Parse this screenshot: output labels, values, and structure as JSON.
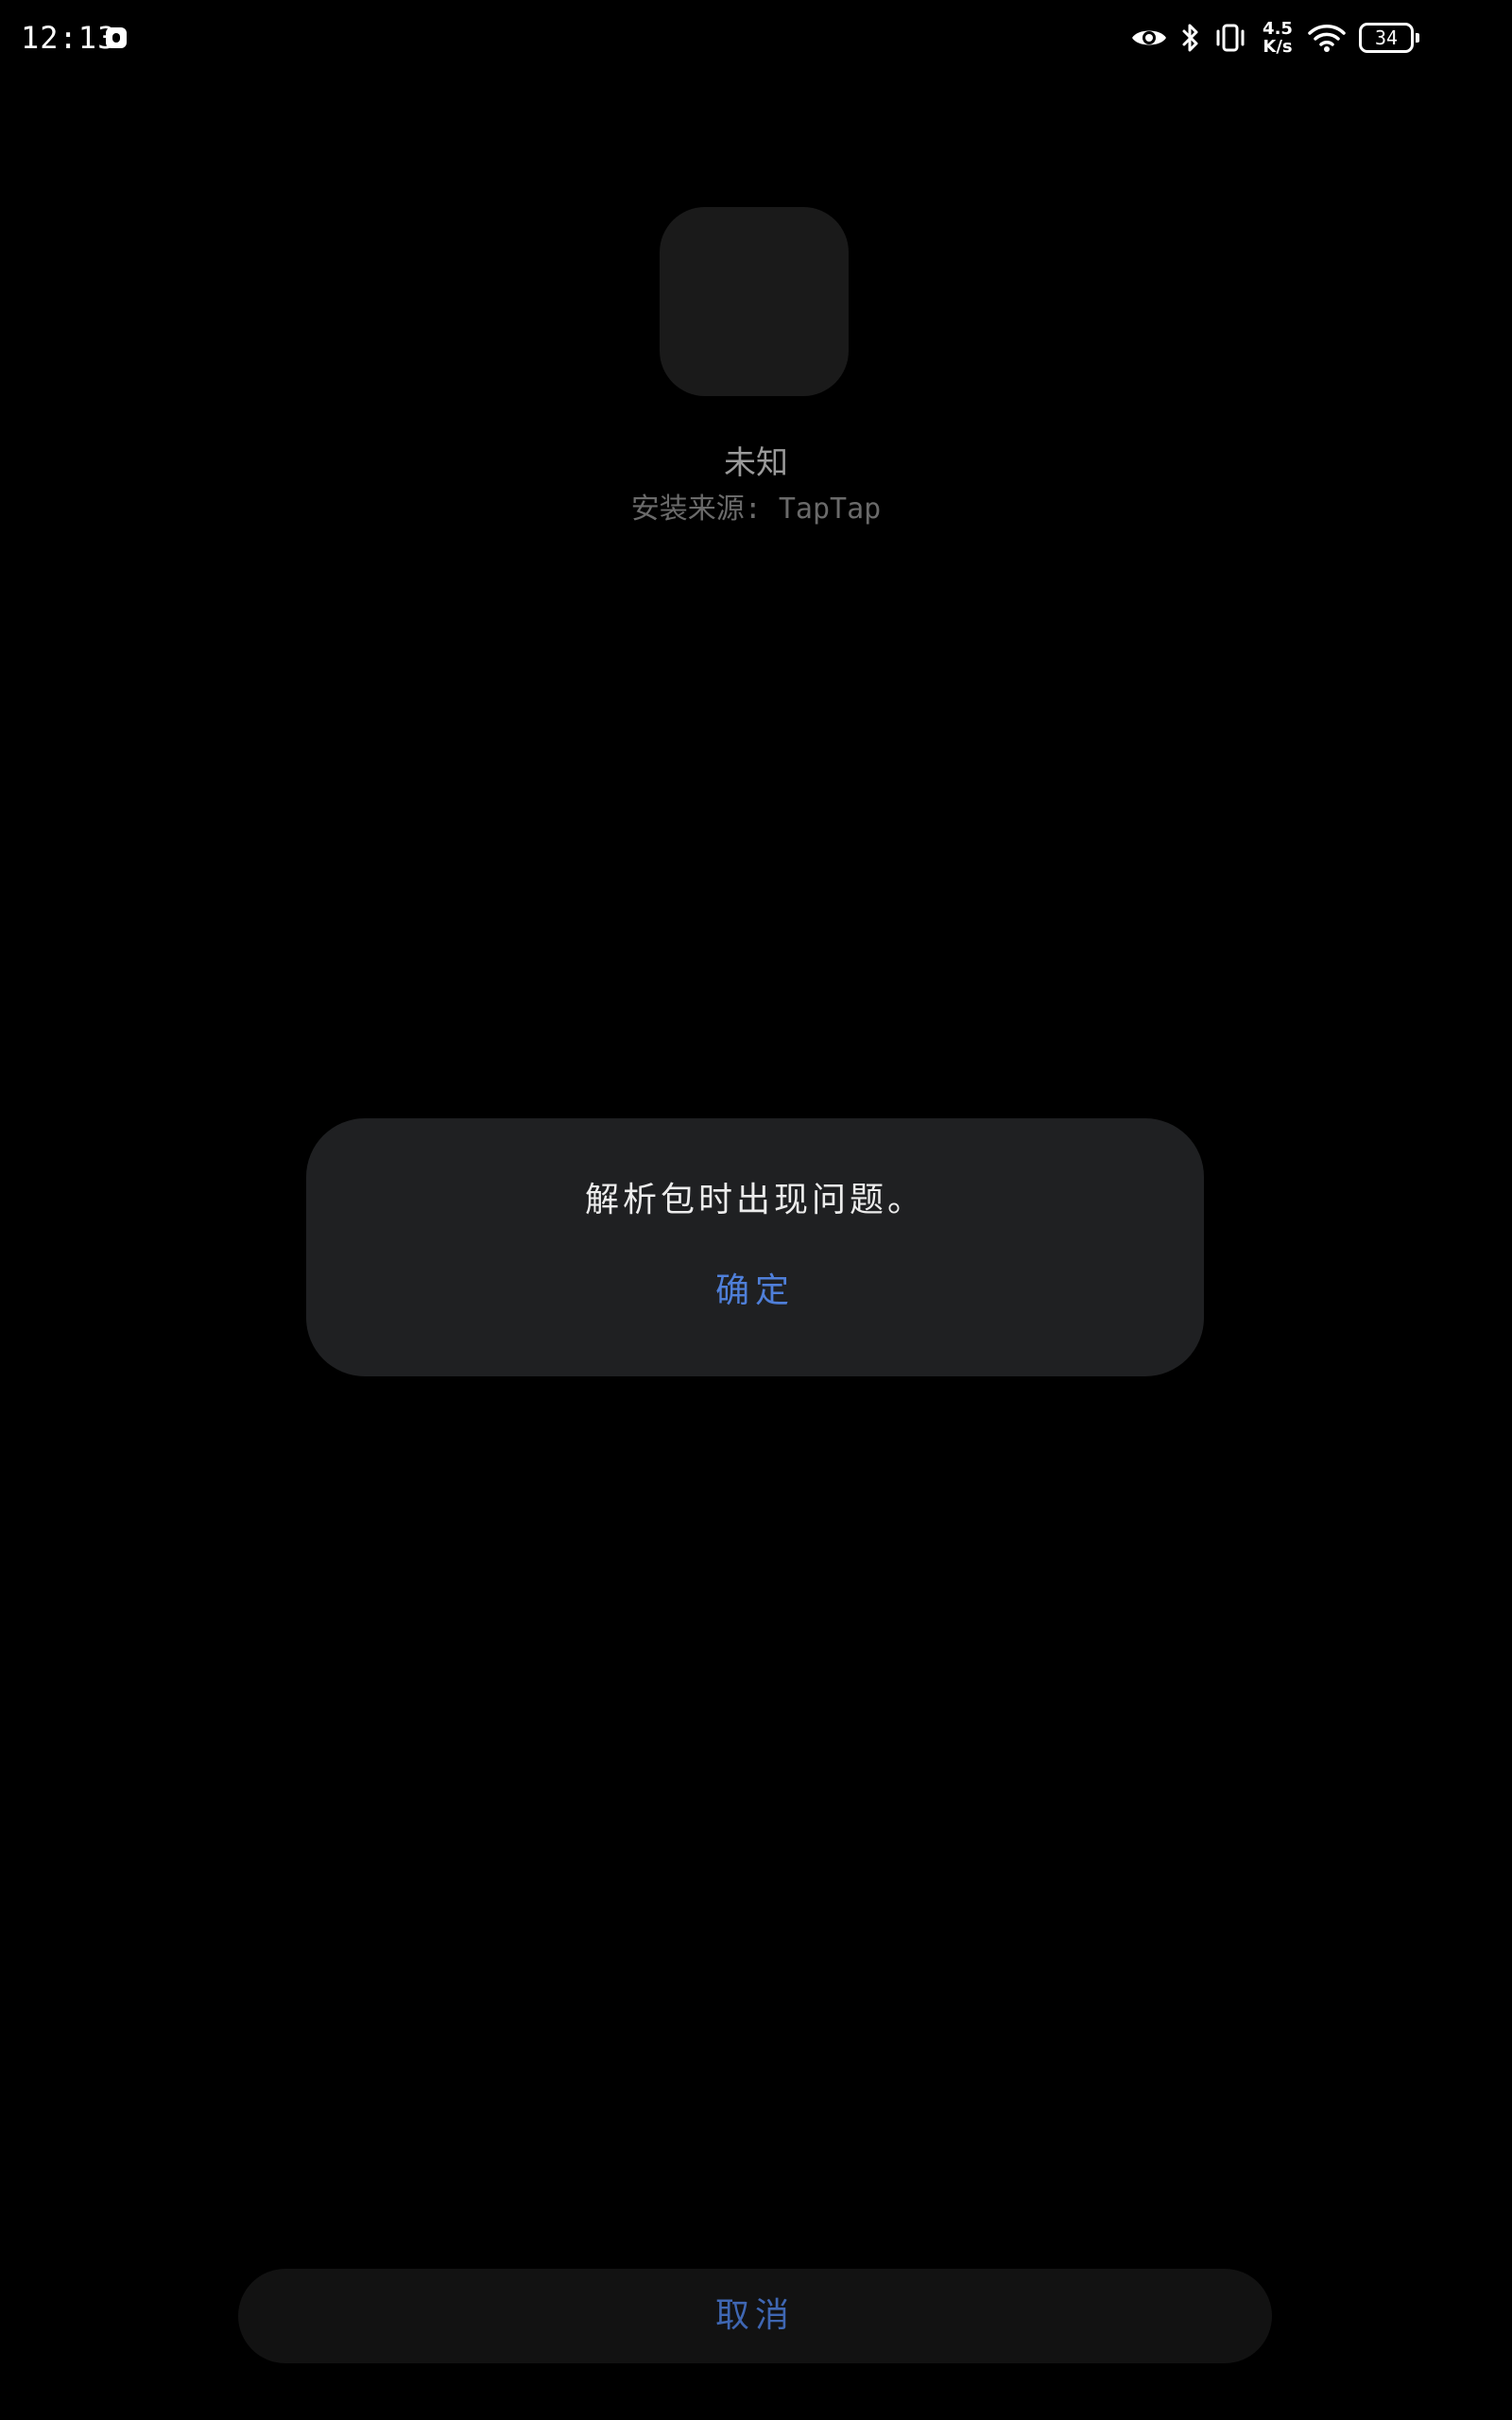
{
  "status_bar": {
    "time": "12:13",
    "net_speed_value": "4.5",
    "net_speed_unit": "K/s",
    "battery_level": "34",
    "icons": [
      "notification-icon",
      "eye-icon",
      "bluetooth-icon",
      "vibrate-icon",
      "wifi-icon",
      "battery-icon"
    ]
  },
  "app": {
    "name": "未知",
    "install_source": "安装来源: TapTap"
  },
  "dialog": {
    "message": "解析包时出现问题。",
    "confirm_label": "确定"
  },
  "footer": {
    "cancel_label": "取消"
  },
  "colors": {
    "background": "#000000",
    "dialog_bg": "#1f2022",
    "accent": "#4f7fd9",
    "cancel_text": "#3f67b3"
  }
}
